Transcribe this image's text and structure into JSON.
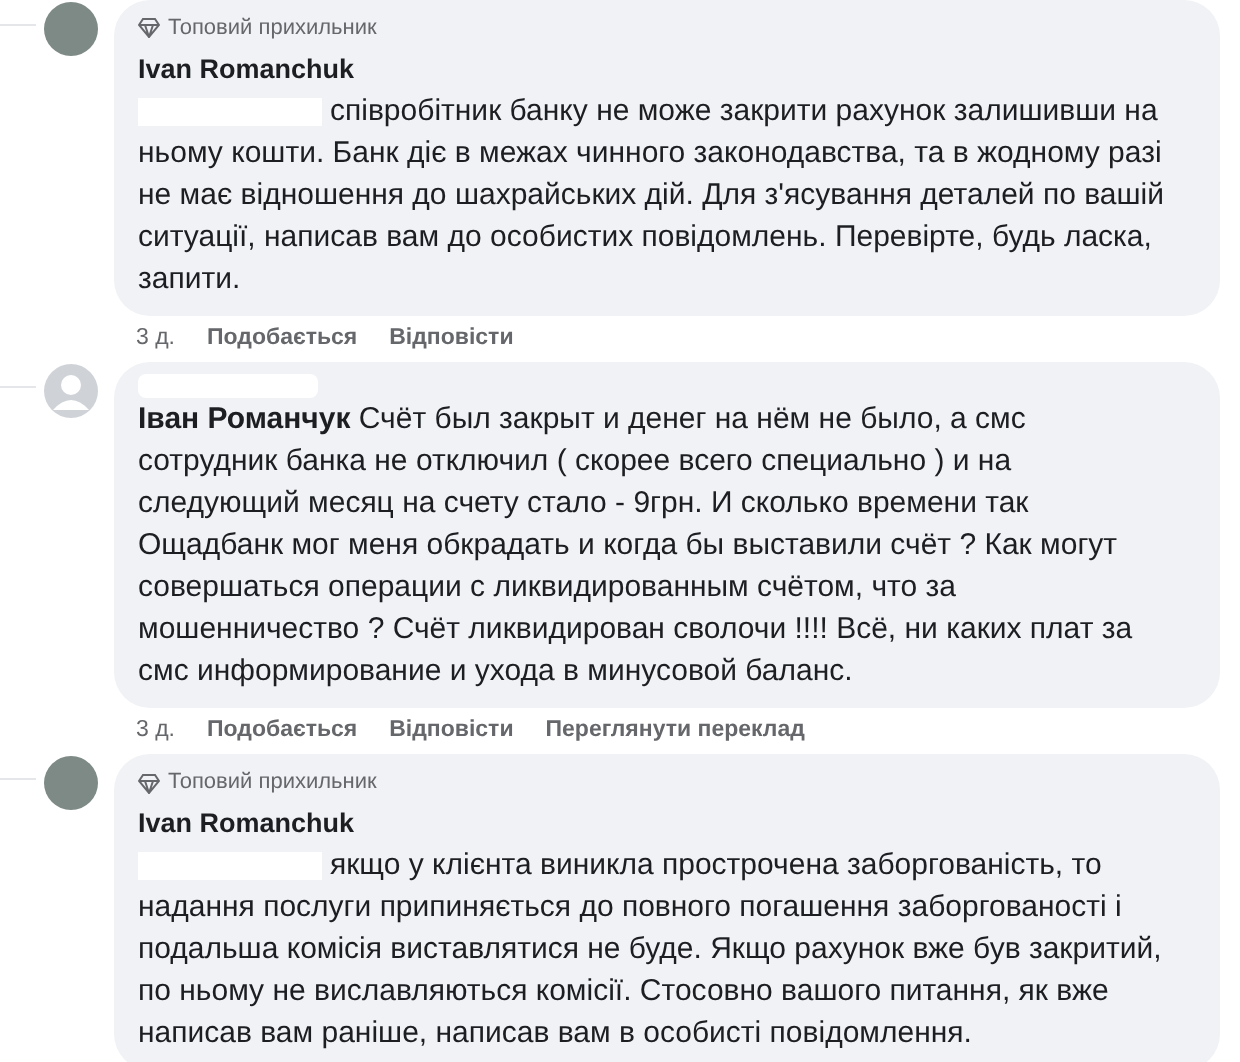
{
  "comments": [
    {
      "avatar": {
        "kind": "photo"
      },
      "badge": "Топовий прихильник",
      "author": "Ivan Romanchuk",
      "redacted_author": false,
      "redacted_mention": true,
      "text": "співробітник банку не може закрити рахунок залишивши на ньому кошти. Банк діє в межах чинного законодавства, та в жодному разі не має відношення до шахрайських дій. Для з'ясування деталей по вашій ситуації, написав вам до особистих повідомлень. Перевірте, будь ласка, запити.",
      "actions": [
        {
          "kind": "time",
          "label": "3 д."
        },
        {
          "kind": "link",
          "label": "Подобається"
        },
        {
          "kind": "link",
          "label": "Відповісти"
        }
      ]
    },
    {
      "avatar": {
        "kind": "default"
      },
      "redacted_author": true,
      "redacted_mention": false,
      "text": "**Іван Романчук** Счёт был закрыт и денег на нём не было, а смс сотрудник банка не отключил ( скорее всего специально ) и на следующий месяц на счету стало - 9грн. И сколько времени так Ощадбанк мог меня обкрадать и когда бы выставили счёт ? Как могут совершаться операции с ликвидированным счётом, что за мошенничество ? Счёт ликвидирован сволочи !!!! Всё, ни каких плат за смс информирование и ухода в минусовой баланс.",
      "actions": [
        {
          "kind": "time",
          "label": "3 д."
        },
        {
          "kind": "link",
          "label": "Подобається"
        },
        {
          "kind": "link",
          "label": "Відповісти"
        },
        {
          "kind": "link",
          "label": "Переглянути переклад"
        }
      ]
    },
    {
      "avatar": {
        "kind": "photo"
      },
      "badge": "Топовий прихильник",
      "author": "Ivan Romanchuk",
      "redacted_author": false,
      "redacted_mention": true,
      "text": "якщо у клієнта виникла прострочена заборгованість, то надання послуги припиняється до повного погашення заборгованості і подальша комісія виставлятися не буде. Якщо рахунок вже був закритий, по ньому не виславляються комісії. Стосовно вашого питання, як вже написав вам раніше, написав вам в особисті повідомлення."
    }
  ]
}
